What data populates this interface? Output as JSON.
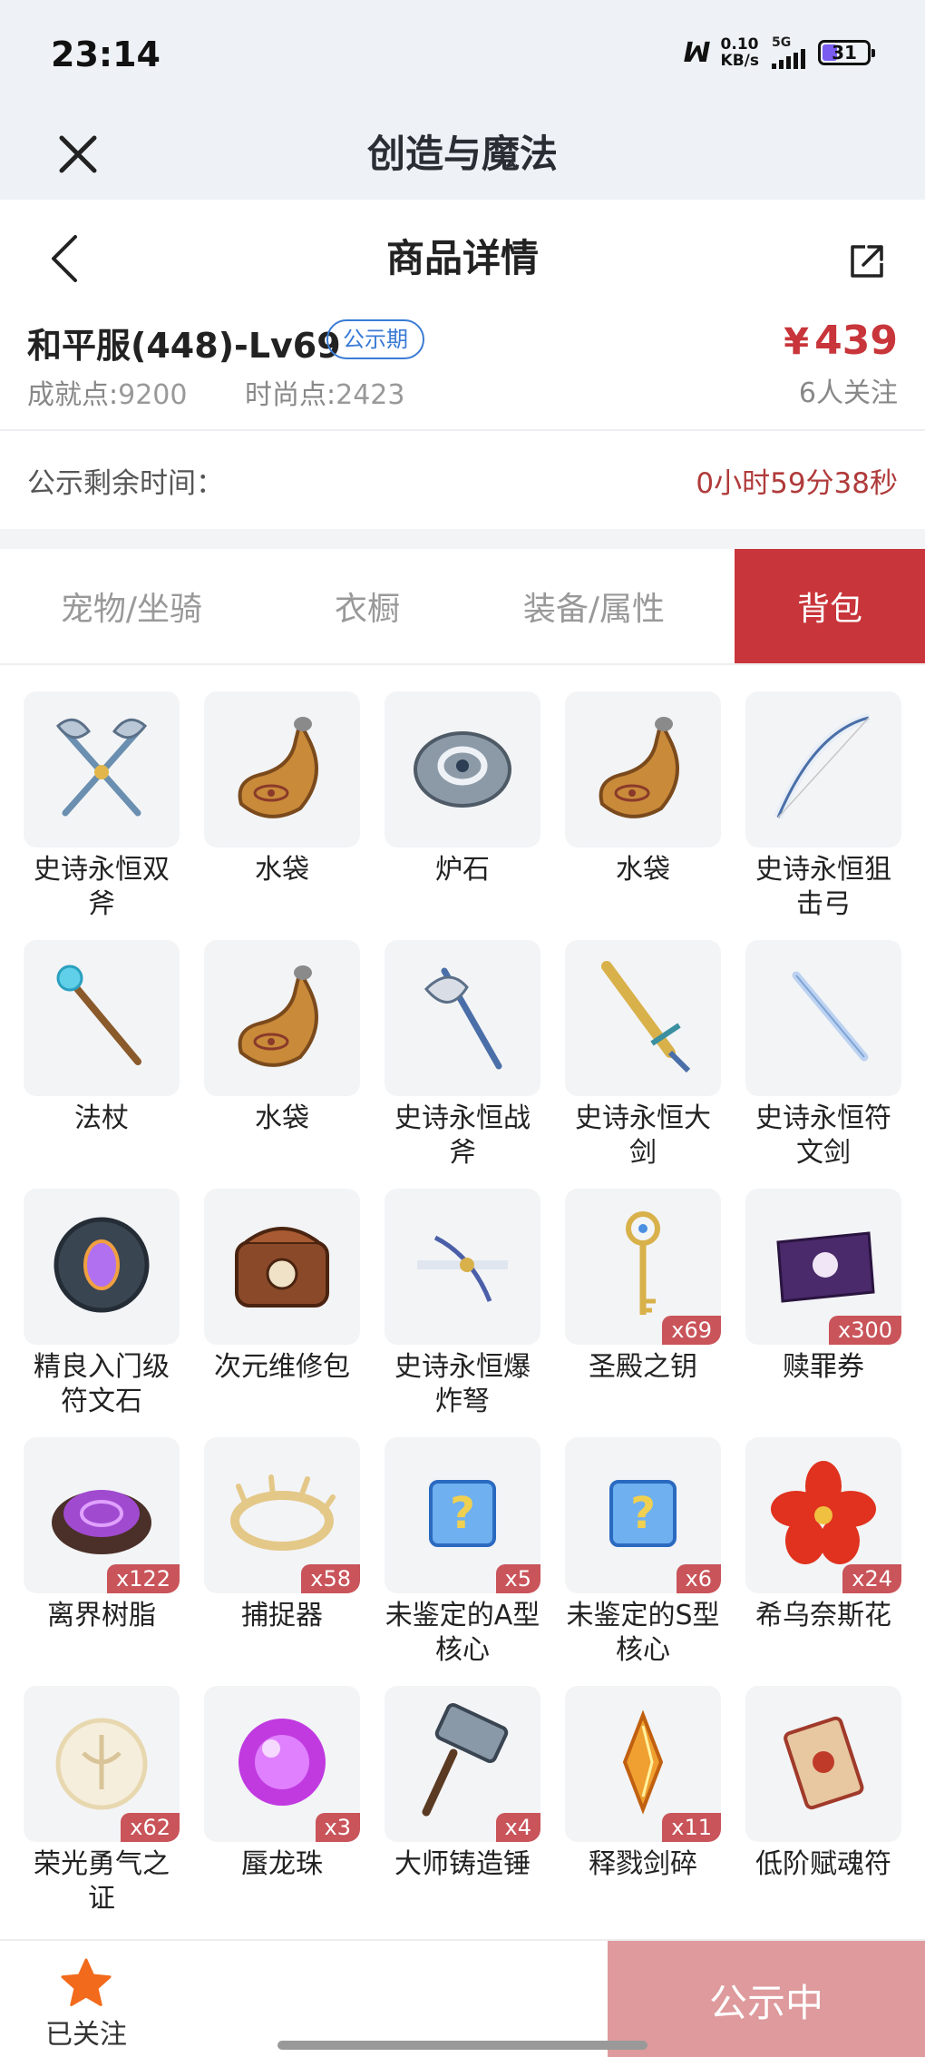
{
  "status_bar": {
    "time": "23:14",
    "network_logo": "ꟽ",
    "speed_value": "0.10",
    "speed_unit": "KB/s",
    "signal_label": "5G",
    "battery": "31"
  },
  "app_bar": {
    "title": "创造与魔法",
    "close_icon": "✕"
  },
  "detail_nav": {
    "title": "商品详情"
  },
  "listing": {
    "name": "和平服(448)-Lv69",
    "badge": "公示期",
    "achievement_label": "成就点:",
    "achievement_value": "9200",
    "fashion_label": "时尚点:",
    "fashion_value": "2423",
    "currency": "¥",
    "price": "439",
    "followers": "6人关注"
  },
  "countdown": {
    "label": "公示剩余时间：",
    "value": "0小时59分38秒"
  },
  "tabs": [
    {
      "label": "宠物/坐骑"
    },
    {
      "label": "衣橱"
    },
    {
      "label": "装备/属性"
    },
    {
      "label": "背包"
    }
  ],
  "items": [
    {
      "name": "史诗永恒双斧",
      "qty": "",
      "icon": "double-axe-icon"
    },
    {
      "name": "水袋",
      "qty": "",
      "icon": "water-bag-icon"
    },
    {
      "name": "炉石",
      "qty": "",
      "icon": "hearthstone-icon"
    },
    {
      "name": "水袋",
      "qty": "",
      "icon": "water-bag-icon"
    },
    {
      "name": "史诗永恒狙击弓",
      "qty": "",
      "icon": "bow-icon"
    },
    {
      "name": "法杖",
      "qty": "",
      "icon": "staff-icon"
    },
    {
      "name": "水袋",
      "qty": "",
      "icon": "water-bag-icon"
    },
    {
      "name": "史诗永恒战斧",
      "qty": "",
      "icon": "battle-axe-icon"
    },
    {
      "name": "史诗永恒大剑",
      "qty": "",
      "icon": "greatsword-icon"
    },
    {
      "name": "史诗永恒符文剑",
      "qty": "",
      "icon": "rune-sword-icon"
    },
    {
      "name": "精良入门级符文石",
      "qty": "",
      "icon": "rune-stone-icon"
    },
    {
      "name": "次元维修包",
      "qty": "",
      "icon": "repair-kit-icon"
    },
    {
      "name": "史诗永恒爆炸弩",
      "qty": "",
      "icon": "crossbow-icon"
    },
    {
      "name": "圣殿之钥",
      "qty": "x69",
      "icon": "key-icon"
    },
    {
      "name": "赎罪券",
      "qty": "x300",
      "icon": "ticket-icon"
    },
    {
      "name": "离界树脂",
      "qty": "x122",
      "icon": "resin-icon"
    },
    {
      "name": "捕捉器",
      "qty": "x58",
      "icon": "catcher-icon"
    },
    {
      "name": "未鉴定的A型核心",
      "qty": "x5",
      "icon": "mystery-box-icon"
    },
    {
      "name": "未鉴定的S型核心",
      "qty": "x6",
      "icon": "mystery-box-icon"
    },
    {
      "name": "希乌奈斯花",
      "qty": "x24",
      "icon": "flower-icon"
    },
    {
      "name": "荣光勇气之证",
      "qty": "x62",
      "icon": "emblem-icon"
    },
    {
      "name": "蜃龙珠",
      "qty": "x3",
      "icon": "orb-icon"
    },
    {
      "name": "大师铸造锤",
      "qty": "x4",
      "icon": "hammer-icon"
    },
    {
      "name": "释戮剑碎",
      "qty": "x11",
      "icon": "shard-icon"
    },
    {
      "name": "低阶赋魂符",
      "qty": "",
      "icon": "scroll-icon"
    }
  ],
  "bottom_bar": {
    "follow_label": "已关注",
    "status_button": "公示中"
  },
  "colors": {
    "accent": "#c8353a",
    "badge_blue": "#3a7bd5",
    "status_button": "#de9a9c",
    "star": "#f26a1b"
  }
}
